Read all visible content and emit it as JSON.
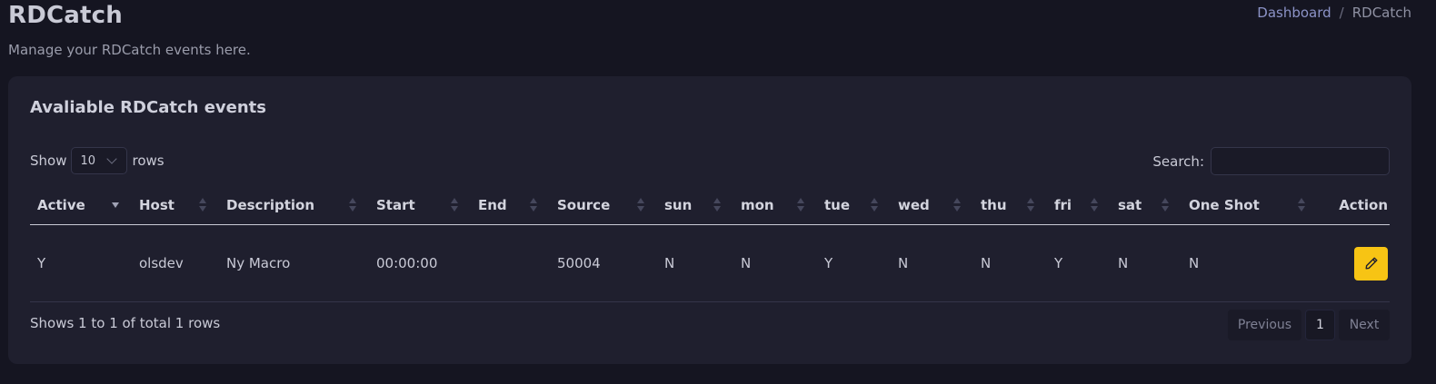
{
  "header": {
    "title": "RDCatch",
    "subtitle": "Manage your RDCatch events here.",
    "breadcrumb": {
      "home": "Dashboard",
      "separator": "/",
      "current": "RDCatch"
    }
  },
  "card": {
    "title": "Avaliable RDCatch events",
    "length": {
      "prefix": "Show",
      "selected": "10",
      "suffix": "rows"
    },
    "search": {
      "label": "Search:",
      "value": "",
      "placeholder": ""
    },
    "table": {
      "columns": [
        "Active",
        "Host",
        "Description",
        "Start",
        "End",
        "Source",
        "sun",
        "mon",
        "tue",
        "wed",
        "thu",
        "fri",
        "sat",
        "One Shot",
        "Action"
      ],
      "sorted_column": "Active",
      "sort_direction": "descending",
      "rows": [
        {
          "active": "Y",
          "host": "olsdev",
          "description": "Ny Macro",
          "start": "00:00:00",
          "end": "",
          "source": "50004",
          "sun": "N",
          "mon": "N",
          "tue": "Y",
          "wed": "N",
          "thu": "N",
          "fri": "Y",
          "sat": "N",
          "one_shot": "N",
          "action_icon": "pencil-icon"
        }
      ]
    },
    "info": "Shows 1 to 1 of total 1 rows",
    "pagination": {
      "previous": "Previous",
      "current_page": "1",
      "next": "Next"
    }
  },
  "colors": {
    "background": "#151521",
    "card": "#1f1f2e",
    "edit_button": "#f7c414",
    "link": "#8c93c7"
  }
}
